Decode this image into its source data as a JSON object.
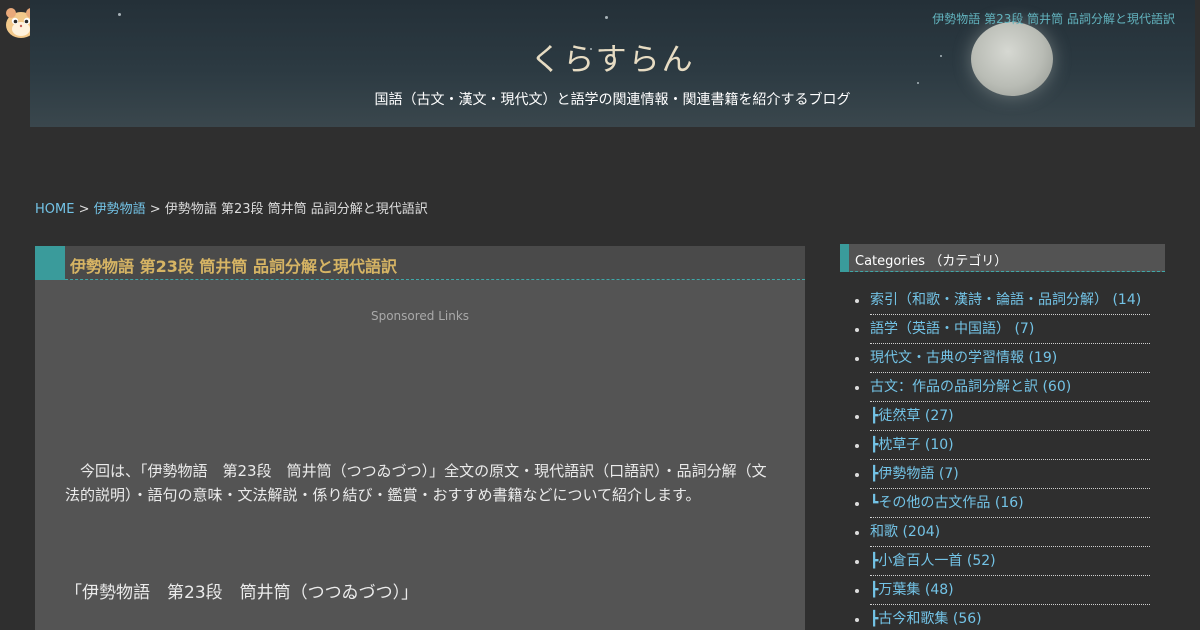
{
  "header": {
    "top_link": "伊勢物語 第23段 筒井筒 品詞分解と現代語訳",
    "site_title": "くらすらん",
    "site_desc": "国語（古文・漢文・現代文）と語学の関連情報・関連書籍を紹介するブログ"
  },
  "breadcrumb": {
    "home": "HOME",
    "sep1": ">",
    "category": "伊勢物語",
    "sep2": ">",
    "current": "伊勢物語 第23段 筒井筒 品詞分解と現代語訳"
  },
  "post": {
    "title": "伊勢物語 第23段 筒井筒 品詞分解と現代語訳",
    "sponsored": "Sponsored Links",
    "intro": "今回は、「伊勢物語　第23段　筒井筒（つつゐづつ）」全文の原文・現代語訳（口語訳）・品詞分解（文法的説明）・語句の意味・文法解説・係り結び・鑑賞・おすすめ書籍などについて紹介します。",
    "heading": "「伊勢物語　第23段　筒井筒（つつゐづつ）」"
  },
  "sidebar": {
    "categories_title": "Categories （カテゴリ）",
    "items": [
      "索引（和歌・漢詩・論語・品詞分解） (14)",
      "語学（英語・中国語） (7)",
      "現代文・古典の学習情報 (19)",
      "古文：作品の品詞分解と訳 (60)",
      "┣徒然草 (27)",
      "┣枕草子 (10)",
      "┣伊勢物語 (7)",
      "┗その他の古文作品 (16)",
      "和歌 (204)",
      "┣小倉百人一首 (52)",
      "┣万葉集 (48)",
      "┣古今和歌集 (56)"
    ]
  },
  "colors": {
    "background": "#2f2f2f",
    "accent": "#3a9b9b",
    "link": "#73c3e6",
    "title": "#d6b464"
  }
}
